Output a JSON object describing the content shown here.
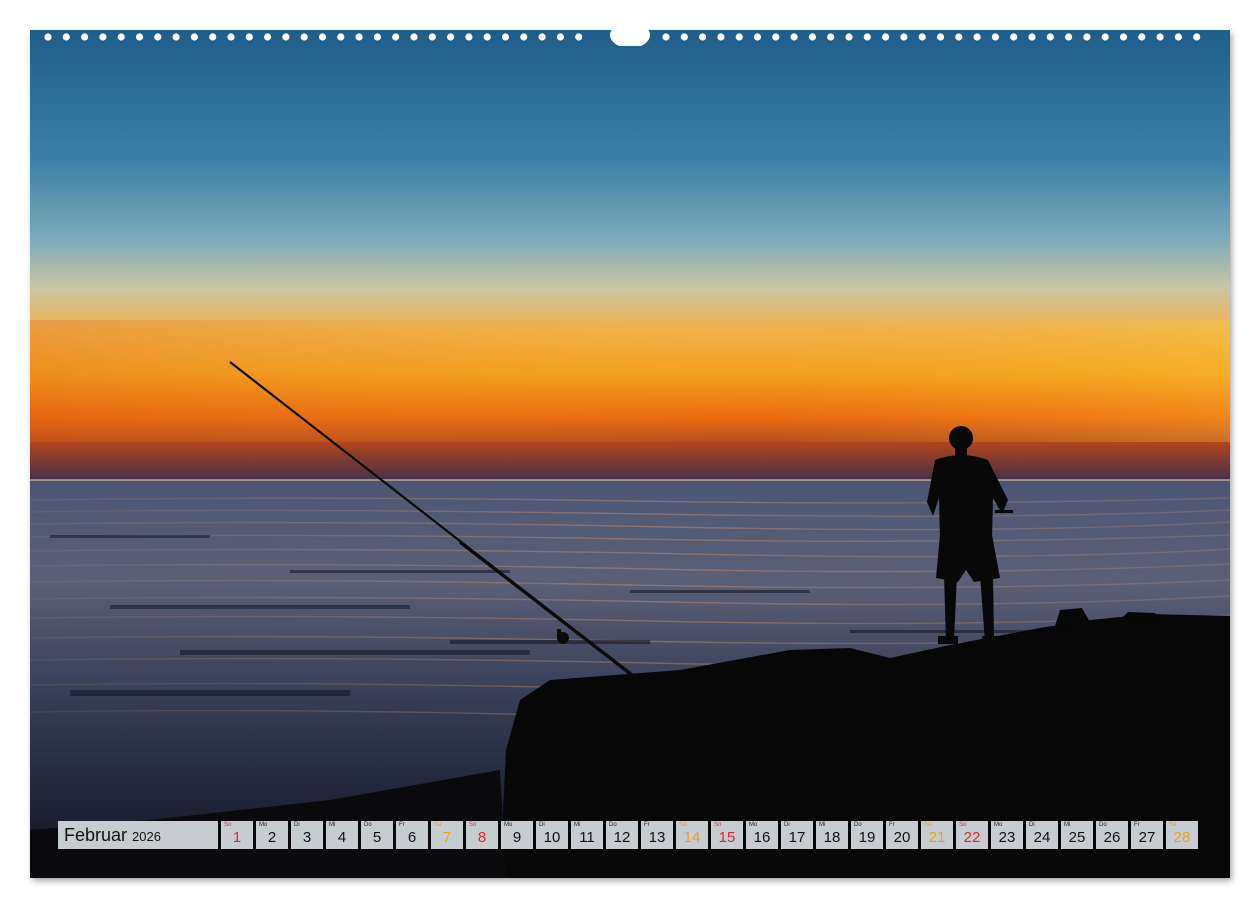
{
  "calendar": {
    "month": "Februar",
    "year": "2026",
    "days": [
      {
        "wd": "So",
        "num": "1",
        "type": "sun"
      },
      {
        "wd": "Mo",
        "num": "2",
        "type": "work"
      },
      {
        "wd": "Di",
        "num": "3",
        "type": "work"
      },
      {
        "wd": "Mi",
        "num": "4",
        "type": "work"
      },
      {
        "wd": "Do",
        "num": "5",
        "type": "work"
      },
      {
        "wd": "Fr",
        "num": "6",
        "type": "work"
      },
      {
        "wd": "Sa",
        "num": "7",
        "type": "sat"
      },
      {
        "wd": "So",
        "num": "8",
        "type": "sun"
      },
      {
        "wd": "Mo",
        "num": "9",
        "type": "work"
      },
      {
        "wd": "Di",
        "num": "10",
        "type": "work"
      },
      {
        "wd": "Mi",
        "num": "11",
        "type": "work"
      },
      {
        "wd": "Do",
        "num": "12",
        "type": "work"
      },
      {
        "wd": "Fr",
        "num": "13",
        "type": "work"
      },
      {
        "wd": "Sa",
        "num": "14",
        "type": "sat"
      },
      {
        "wd": "So",
        "num": "15",
        "type": "sun"
      },
      {
        "wd": "Mo",
        "num": "16",
        "type": "work"
      },
      {
        "wd": "Di",
        "num": "17",
        "type": "work"
      },
      {
        "wd": "Mi",
        "num": "18",
        "type": "work"
      },
      {
        "wd": "Do",
        "num": "19",
        "type": "work"
      },
      {
        "wd": "Fr",
        "num": "20",
        "type": "work"
      },
      {
        "wd": "Sa",
        "num": "21",
        "type": "sat"
      },
      {
        "wd": "So",
        "num": "22",
        "type": "sun"
      },
      {
        "wd": "Mo",
        "num": "23",
        "type": "work"
      },
      {
        "wd": "Di",
        "num": "24",
        "type": "work"
      },
      {
        "wd": "Mi",
        "num": "25",
        "type": "work"
      },
      {
        "wd": "Do",
        "num": "26",
        "type": "work"
      },
      {
        "wd": "Fr",
        "num": "27",
        "type": "work"
      },
      {
        "wd": "Sa",
        "num": "28",
        "type": "sat"
      }
    ]
  },
  "colors": {
    "sunday": "#e0272b",
    "saturday": "#e7a11d",
    "cell_background": "#c6ccd0"
  },
  "icons": {
    "binding": "wire-binding-icon"
  }
}
